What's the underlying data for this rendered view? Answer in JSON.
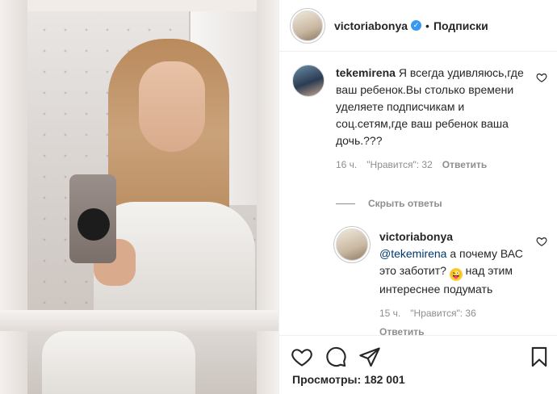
{
  "post": {
    "author": "victoriabonya",
    "follow_status": "Подписки",
    "views_label": "Просмотры:",
    "views_count": "182 001"
  },
  "comments": [
    {
      "author": "tekemirena",
      "text": "Я всегда удивляюсь,где ваш ребенок.Вы столько времени уделяете подписчикам и соц.сетям,где ваш ребенок ваша дочь.???",
      "time": "16 ч.",
      "likes": "\"Нравится\": 32",
      "reply_label": "Ответить"
    }
  ],
  "hide_replies_label": "Скрыть ответы",
  "reply": {
    "author": "victoriabonya",
    "mention": "@tekemirena",
    "text_before_emoji": " а почему ВАС это заботит?",
    "emoji": "😜",
    "text_after_emoji": " над этим интереснее подумать",
    "time": "15 ч.",
    "likes": "\"Нравится\": 36",
    "reply_label": "Ответить"
  },
  "icons": {
    "like": "heart-icon",
    "comment": "comment-icon",
    "share": "share-icon",
    "save": "bookmark-icon",
    "verified": "verified-badge-icon"
  },
  "colors": {
    "text": "#262626",
    "secondary": "#8e8e8e",
    "mention": "#00376b",
    "verified": "#3897f0"
  }
}
